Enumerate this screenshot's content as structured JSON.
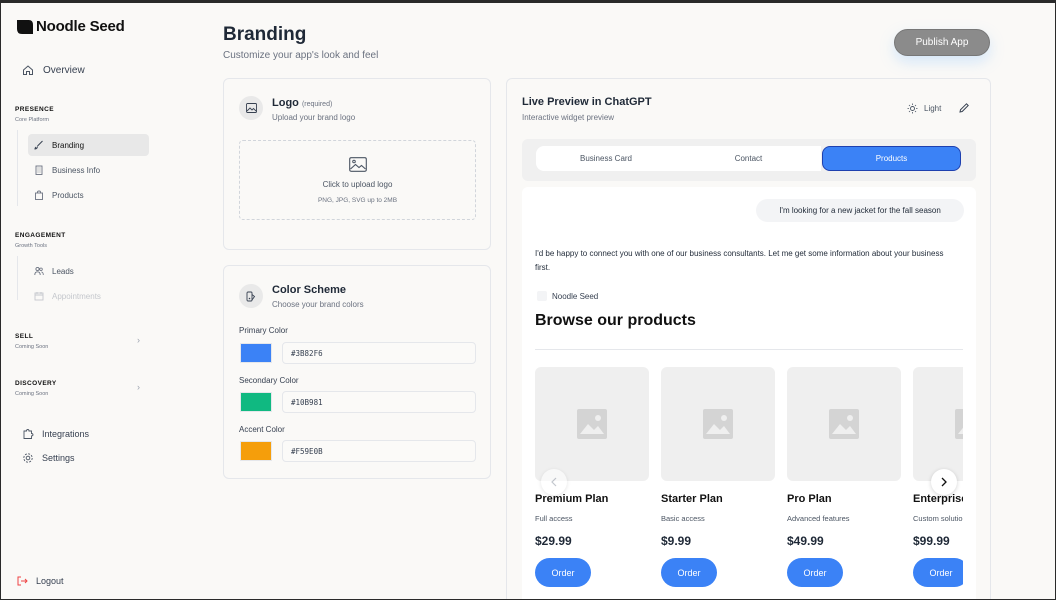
{
  "app": {
    "name": "Noodle Seed"
  },
  "sidebar": {
    "overview": "Overview",
    "sections": [
      {
        "title": "PRESENCE",
        "subtitle": "Core Platform",
        "items": [
          {
            "label": "Branding",
            "icon": "brush-icon",
            "state": "active"
          },
          {
            "label": "Business Info",
            "icon": "building-icon",
            "state": "normal"
          },
          {
            "label": "Products",
            "icon": "bag-icon",
            "state": "normal"
          }
        ]
      },
      {
        "title": "ENGAGEMENT",
        "subtitle": "Growth Tools",
        "items": [
          {
            "label": "Leads",
            "icon": "users-icon",
            "state": "normal"
          },
          {
            "label": "Appointments",
            "icon": "calendar-icon",
            "state": "disabled"
          }
        ]
      },
      {
        "title": "SELL",
        "subtitle": "Coming Soon"
      },
      {
        "title": "DISCOVERY",
        "subtitle": "Coming Soon"
      }
    ],
    "integrations": "Integrations",
    "settings": "Settings",
    "logout": "Logout"
  },
  "header": {
    "title": "Branding",
    "subtitle": "Customize your app's look and feel",
    "publish_label": "Publish App"
  },
  "logo_card": {
    "title": "Logo",
    "required": "(required)",
    "subtitle": "Upload your brand logo",
    "upload_text": "Click to upload logo",
    "upload_hint": "PNG, JPG, SVG up to 2MB"
  },
  "color_card": {
    "title": "Color Scheme",
    "subtitle": "Choose your brand colors",
    "colors": [
      {
        "label": "Primary Color",
        "value": "#3B82F6",
        "hex": "#3B82F6"
      },
      {
        "label": "Secondary Color",
        "value": "#10B981",
        "hex": "#10B981"
      },
      {
        "label": "Accent Color",
        "value": "#F59E0B",
        "hex": "#F59E0B"
      }
    ]
  },
  "preview": {
    "title": "Live Preview in ChatGPT",
    "subtitle": "Interactive widget preview",
    "theme_label": "Light",
    "tabs": [
      "Business Card",
      "Contact",
      "Products"
    ],
    "active_tab": "Products",
    "user_message": "I'm looking for a new jacket for the fall season",
    "assistant_message": "I'd be happy to connect you with one of our business consultants. Let me get some information about your business first.",
    "brand_name": "Noodle Seed",
    "browse_title": "Browse our products",
    "products": [
      {
        "name": "Premium Plan",
        "desc": "Full access",
        "price": "$29.99",
        "cta": "Order"
      },
      {
        "name": "Starter Plan",
        "desc": "Basic access",
        "price": "$9.99",
        "cta": "Order"
      },
      {
        "name": "Pro Plan",
        "desc": "Advanced features",
        "price": "$49.99",
        "cta": "Order"
      },
      {
        "name": "Enterprise",
        "desc": "Custom solutions",
        "price": "$99.99",
        "cta": "Order"
      }
    ]
  },
  "colors": {
    "accent": "#3B82F6",
    "publish_bg": "#8B8B8B"
  }
}
